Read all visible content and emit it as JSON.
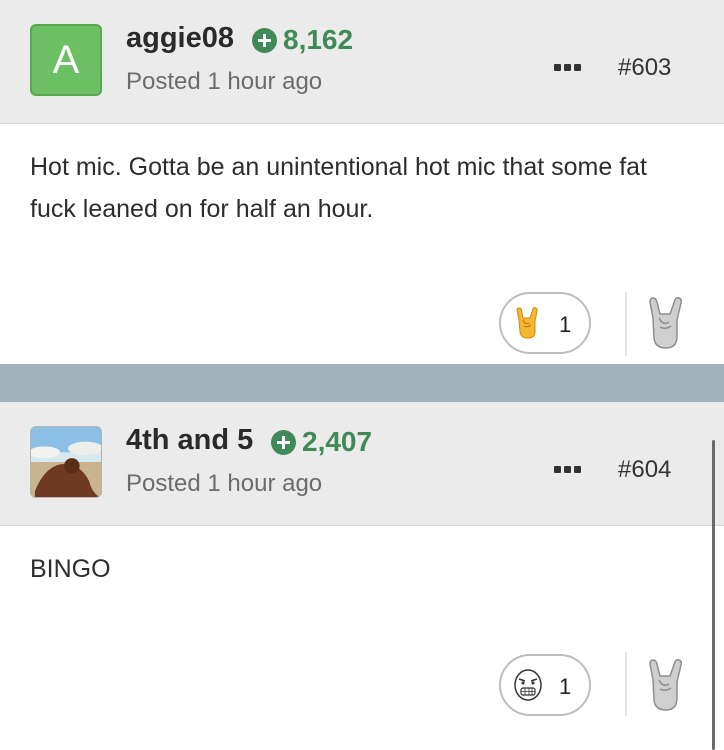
{
  "posts": [
    {
      "avatar_letter": "A",
      "username": "aggie08",
      "reputation": "8,162",
      "posted": "Posted 1 hour ago",
      "post_number": "#603",
      "body": "Hot mic. Gotta be an unintentional hot mic that some fat fuck leaned on for half an hour.",
      "reaction_icon": "rock-on-hand-emoji",
      "reaction_count": "1",
      "react_button_icon": "rock-on-hand-icon"
    },
    {
      "avatar_icon": "beach-photo-avatar",
      "username": "4th and 5",
      "reputation": "2,407",
      "posted": "Posted 1 hour ago",
      "post_number": "#604",
      "body": "BINGO",
      "reaction_icon": "rage-face-emoji",
      "reaction_count": "1",
      "react_button_icon": "rock-on-hand-icon"
    }
  ],
  "colors": {
    "reputation": "#3f8a57",
    "separator": "#a3b1bb",
    "avatar_green": "#6cbf63",
    "header_bg": "#ebebeb"
  }
}
